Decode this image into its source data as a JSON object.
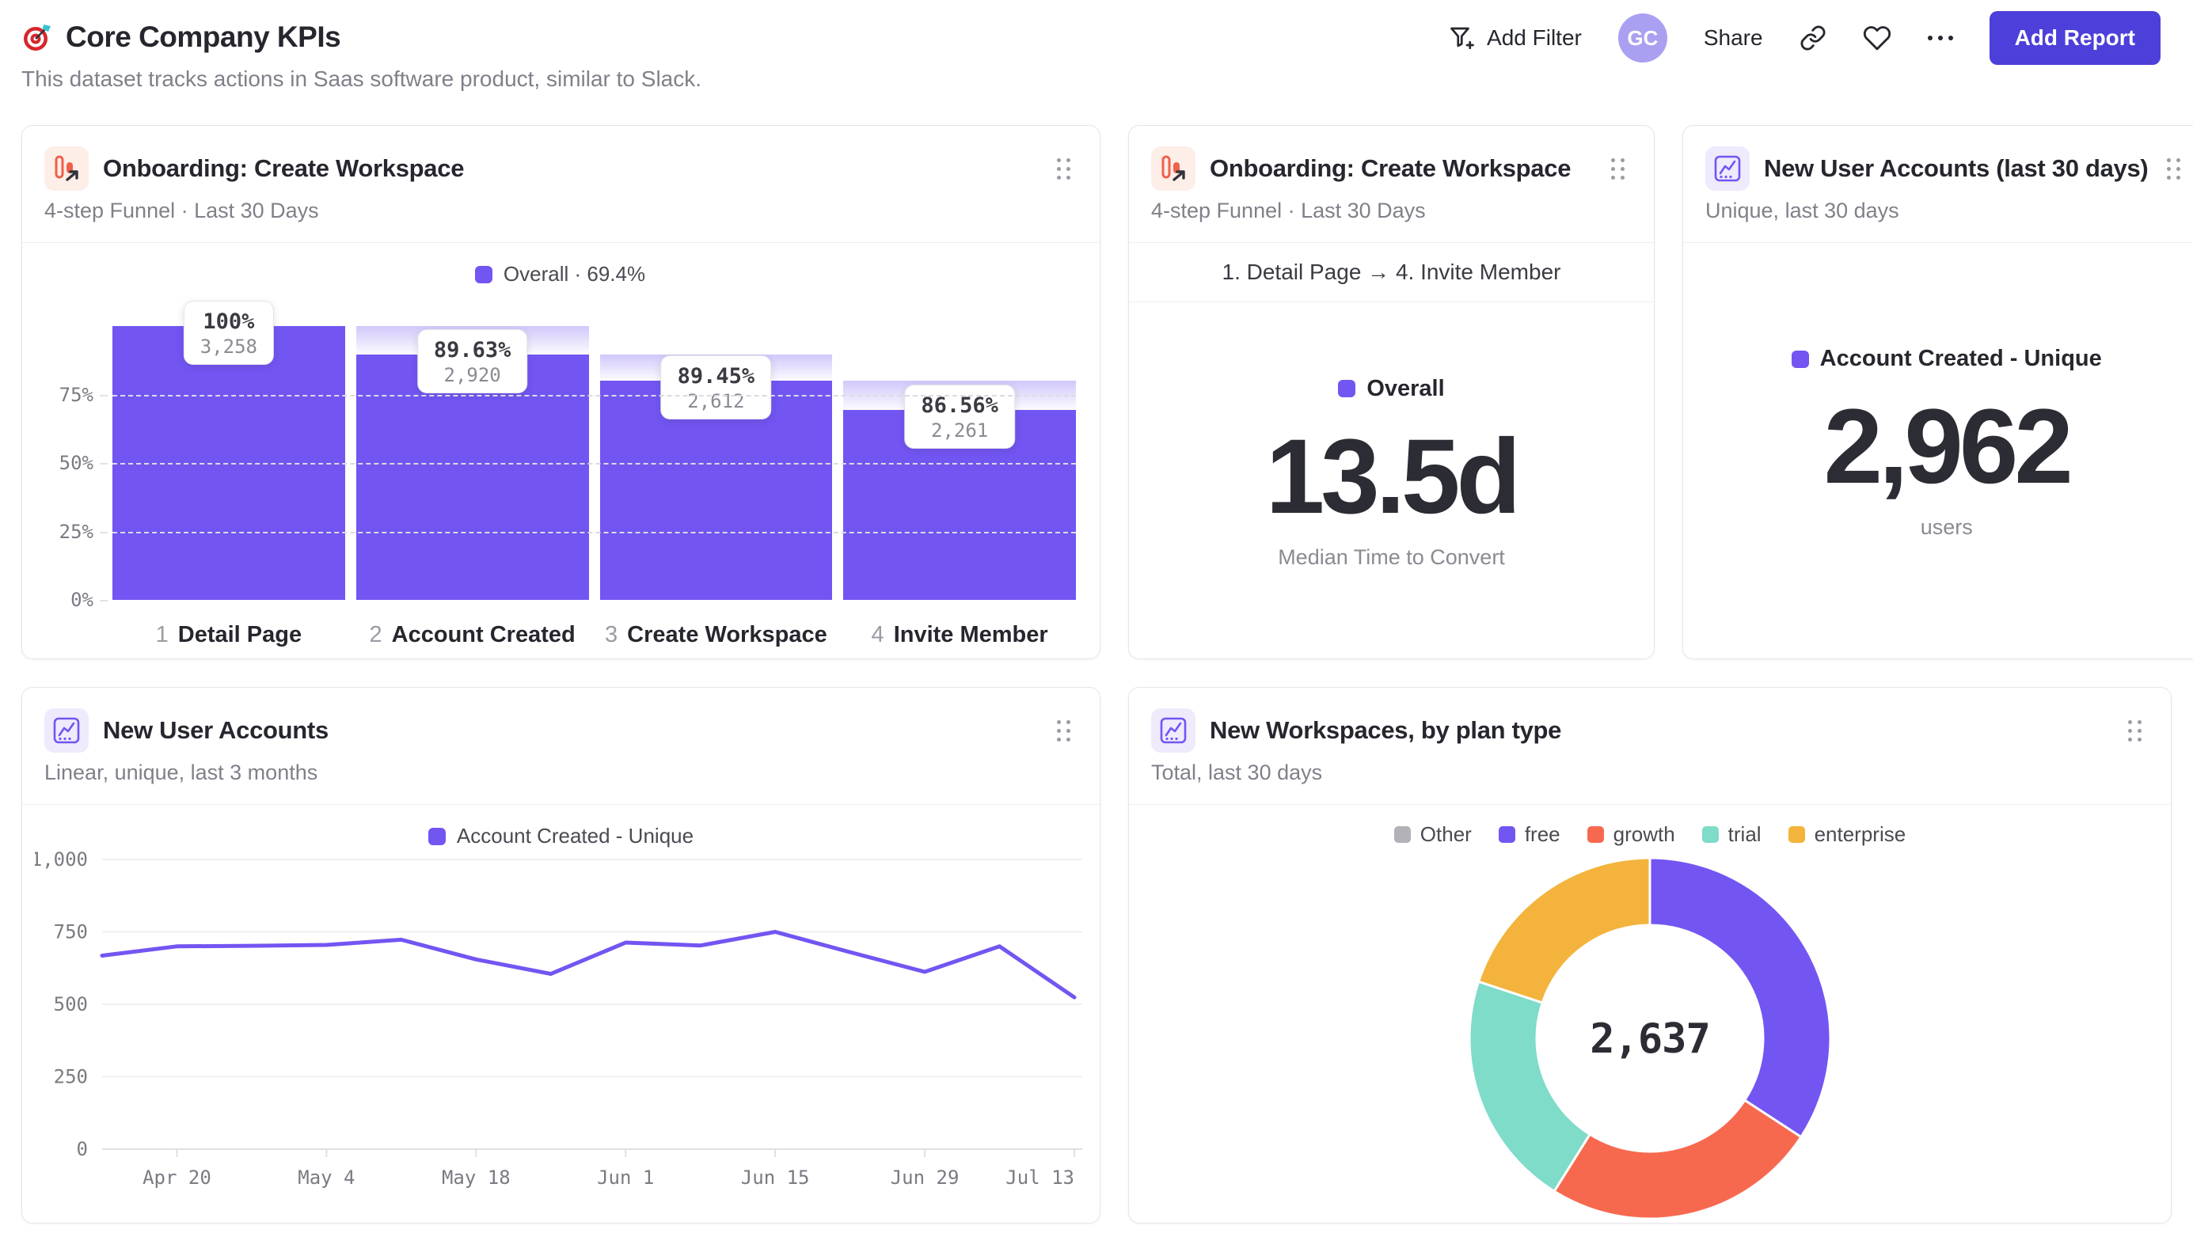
{
  "header": {
    "title": "Core Company KPIs",
    "subtitle": "This dataset tracks actions in Saas software product, similar to Slack.",
    "add_filter": "Add Filter",
    "avatar_initials": "GC",
    "share": "Share",
    "add_report": "Add Report"
  },
  "colors": {
    "purple": "#7355f2",
    "coral": "#f7694f",
    "teal": "#7edcc9",
    "amber": "#f3b33c",
    "gray": "#b2b2b8",
    "button": "#4d3fd9"
  },
  "cards": {
    "funnel_bars": {
      "title": "Onboarding: Create Workspace",
      "subtitle": "4-step Funnel · Last 30 Days",
      "legend": "Overall · 69.4%"
    },
    "funnel_time": {
      "title": "Onboarding: Create Workspace",
      "subtitle": "4-step Funnel · Last 30 Days",
      "range": "1. Detail Page → 4. Invite Member",
      "legend": "Overall",
      "value": "13.5d",
      "value_label": "Median Time to Convert"
    },
    "new_users_30d": {
      "title": "New User Accounts (last 30 days)",
      "subtitle": "Unique, last 30 days",
      "legend": "Account Created - Unique",
      "value": "2,962",
      "value_label": "users"
    },
    "new_users_trend": {
      "title": "New User Accounts",
      "subtitle": "Linear, unique, last 3 months",
      "legend": "Account Created - Unique"
    },
    "workspaces_by_plan": {
      "title": "New Workspaces, by plan type",
      "subtitle": "Total, last 30 days",
      "total": "2,637"
    }
  },
  "chart_data": [
    {
      "id": "onboarding-funnel",
      "type": "bar",
      "title": "Onboarding: Create Workspace",
      "legend": "Overall · 69.4%",
      "ylim": [
        0,
        100
      ],
      "yticks": [
        {
          "v": 75,
          "label": "75%"
        },
        {
          "v": 50,
          "label": "50%"
        },
        {
          "v": 25,
          "label": "25%"
        },
        {
          "v": 0,
          "label": "0%"
        }
      ],
      "grid": "dashed",
      "steps": [
        {
          "index": "1",
          "label": "Detail Page",
          "step_conversion": "100%",
          "count": "3,258",
          "overall_pct": 100
        },
        {
          "index": "2",
          "label": "Account Created",
          "step_conversion": "89.63%",
          "count": "2,920",
          "overall_pct": 89.63
        },
        {
          "index": "3",
          "label": "Create Workspace",
          "step_conversion": "89.45%",
          "count": "2,612",
          "overall_pct": 80.17
        },
        {
          "index": "4",
          "label": "Invite Member",
          "step_conversion": "86.56%",
          "count": "2,261",
          "overall_pct": 69.4
        }
      ]
    },
    {
      "id": "median-time-to-convert",
      "type": "number",
      "series": "Overall",
      "value": "13.5d",
      "label": "Median Time to Convert",
      "step_range": "1. Detail Page → 4. Invite Member"
    },
    {
      "id": "new-user-accounts-30d",
      "type": "number",
      "series": "Account Created - Unique",
      "value": "2,962",
      "label": "users"
    },
    {
      "id": "new-user-accounts-trend",
      "type": "line",
      "series": "Account Created - Unique",
      "x": [
        "Apr 13",
        "Apr 20",
        "Apr 27",
        "May 4",
        "May 11",
        "May 18",
        "May 25",
        "Jun 1",
        "Jun 8",
        "Jun 15",
        "Jun 22",
        "Jun 29",
        "Jul 6",
        "Jul 13"
      ],
      "values": [
        668,
        700,
        702,
        705,
        723,
        655,
        605,
        713,
        703,
        750,
        680,
        612,
        700,
        524
      ],
      "x_tick_labels": [
        "Apr 20",
        "May 4",
        "May 18",
        "Jun 1",
        "Jun 15",
        "Jun 29",
        "Jul 13"
      ],
      "yticks": [
        0,
        250,
        500,
        750,
        1000
      ],
      "ylim": [
        0,
        1000
      ],
      "grid": "horizontal"
    },
    {
      "id": "new-workspaces-by-plan",
      "type": "pie",
      "total": 2637,
      "total_label": "2,637",
      "legend_position": "top",
      "slices": [
        {
          "label": "Other",
          "value": 0,
          "color_key": "gray"
        },
        {
          "label": "free",
          "value": 902,
          "color_key": "purple"
        },
        {
          "label": "growth",
          "value": 651,
          "color_key": "coral"
        },
        {
          "label": "trial",
          "value": 559,
          "color_key": "teal"
        },
        {
          "label": "enterprise",
          "value": 525,
          "color_key": "amber"
        }
      ]
    }
  ]
}
